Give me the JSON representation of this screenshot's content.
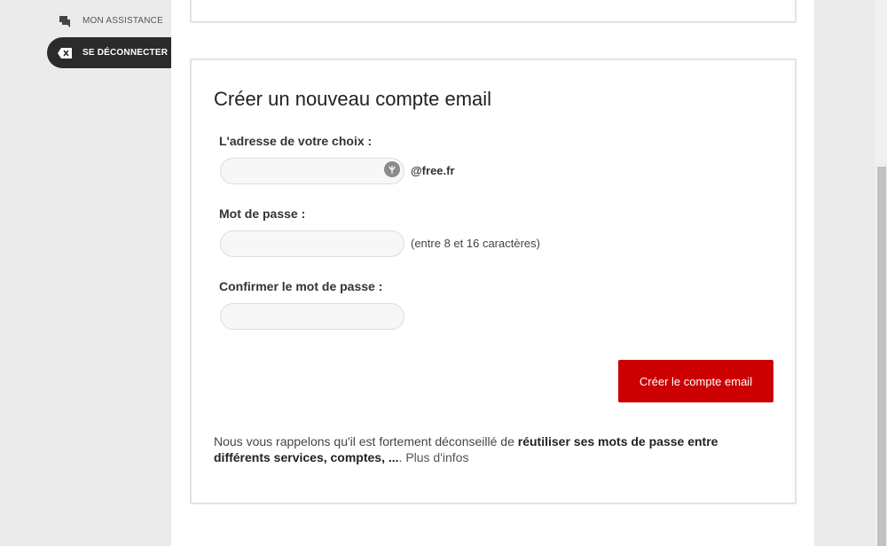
{
  "sidebar": {
    "items": [
      {
        "label": "MON ASSISTANCE",
        "icon": "chat-icon"
      },
      {
        "label": "SE DÉCONNECTER",
        "icon": "logout-icon"
      }
    ]
  },
  "form": {
    "title": "Créer un nouveau compte email",
    "address_label": "L'adresse de votre choix :",
    "address_value": "",
    "domain": "@free.fr",
    "password_label": "Mot de passe :",
    "password_value": "",
    "password_hint": "(entre 8 et 16 caractères)",
    "confirm_label": "Confirmer le mot de passe :",
    "confirm_value": "",
    "submit_label": "Créer le compte email"
  },
  "notice": {
    "text_start": "Nous vous rappelons qu'il est fortement déconseillé de ",
    "text_bold": "réutiliser ses mots de passe entre différents services, comptes, ...",
    "text_after": ". ",
    "more_link": "Plus d'infos"
  },
  "colors": {
    "accent": "#cc0000",
    "nav_active": "#2b2b2b"
  }
}
